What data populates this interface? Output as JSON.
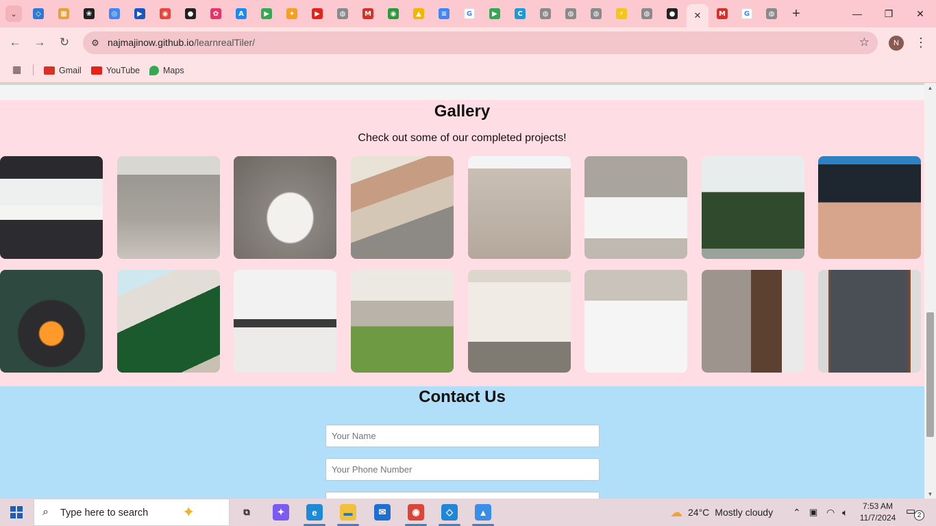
{
  "browser": {
    "tabs": [
      {
        "icon": "vscode-icon",
        "color": "#2c7ad6",
        "glyph": "◇"
      },
      {
        "icon": "analytics-icon",
        "color": "#e8a03a",
        "glyph": "▦"
      },
      {
        "icon": "chatgpt-icon",
        "color": "#222222",
        "glyph": "❀"
      },
      {
        "icon": "google-lens-icon",
        "color": "#4285f4",
        "glyph": "◎"
      },
      {
        "icon": "jira-icon",
        "color": "#1558c0",
        "glyph": "▶"
      },
      {
        "icon": "app-red-icon",
        "color": "#e8453c",
        "glyph": "◉"
      },
      {
        "icon": "github-icon",
        "color": "#222222",
        "glyph": "●"
      },
      {
        "icon": "butterfly-icon",
        "color": "#e8336b",
        "glyph": "✿"
      },
      {
        "icon": "app-store-icon",
        "color": "#1a8cf0",
        "glyph": "A"
      },
      {
        "icon": "google-play-icon",
        "color": "#34a853",
        "glyph": "▶"
      },
      {
        "icon": "pinwheel-icon",
        "color": "#f4a020",
        "glyph": "✦"
      },
      {
        "icon": "youtube-icon",
        "color": "#e62117",
        "glyph": "▶"
      },
      {
        "icon": "globe-icon",
        "color": "#8a8a8a",
        "glyph": "◍"
      },
      {
        "icon": "gmail-icon",
        "color": "#d93025",
        "glyph": "M"
      },
      {
        "icon": "circle-logo-icon",
        "color": "#2d9a3a",
        "glyph": "◉"
      },
      {
        "icon": "google-drive-icon",
        "color": "#f5b400",
        "glyph": "▲"
      },
      {
        "icon": "google-docs-icon",
        "color": "#4285f4",
        "glyph": "≡"
      },
      {
        "icon": "google-icon",
        "color": "#ffffff",
        "glyph": "G"
      },
      {
        "icon": "google-play-icon",
        "color": "#34a853",
        "glyph": "▶"
      },
      {
        "icon": "edge-c-icon",
        "color": "#1a9ad6",
        "glyph": "C"
      },
      {
        "icon": "globe-icon",
        "color": "#8a8a8a",
        "glyph": "◍"
      },
      {
        "icon": "globe-icon",
        "color": "#8a8a8a",
        "glyph": "◍"
      },
      {
        "icon": "globe-icon",
        "color": "#8a8a8a",
        "glyph": "◍"
      },
      {
        "icon": "bolt-icon",
        "color": "#f5c518",
        "glyph": "⚡"
      },
      {
        "icon": "globe-icon",
        "color": "#8a8a8a",
        "glyph": "◍"
      },
      {
        "icon": "github-icon",
        "color": "#222222",
        "glyph": "●"
      }
    ],
    "tabs_after_active": [
      {
        "icon": "gmail-icon",
        "color": "#d93025",
        "glyph": "M"
      },
      {
        "icon": "google-icon",
        "color": "#ffffff",
        "glyph": "G"
      },
      {
        "icon": "globe-icon",
        "color": "#8a8a8a",
        "glyph": "◍"
      }
    ],
    "active_tab_close": "✕",
    "url_host": "najmajinow.github.io",
    "url_path": "/learnrealTiler/",
    "profile_initial": "N",
    "bookmarks": [
      {
        "label": "Gmail",
        "icon": "gmail-icon",
        "color": "#d93025"
      },
      {
        "label": "YouTube",
        "icon": "youtube-icon",
        "color": "#e62117"
      },
      {
        "label": "Maps",
        "icon": "maps-icon",
        "color": "#34a853"
      }
    ]
  },
  "page": {
    "gallery": {
      "title": "Gallery",
      "subtitle": "Check out some of our completed projects!",
      "photos": [
        {
          "name": "kitchen-sink-photo",
          "bg": "linear-gradient(180deg,#2a2a2e 0 22%,#eef0f0 22% 48%,#f4f4f2 48% 62%,#2c2c30 62%)"
        },
        {
          "name": "grey-floor-tiles-photo",
          "bg": "linear-gradient(180deg,#d9d7d2 0 18%,#9b9792 18%,#a8a39d 60%,#c8c3bc 100%)"
        },
        {
          "name": "corner-bathtub-photo",
          "bg": "radial-gradient(ellipse at 55% 60%,#f3f1ee 0 28%,#8a8480 30%,#6e6863 100%)"
        },
        {
          "name": "outdoor-paving-photo",
          "bg": "linear-gradient(160deg,#e9e2d6 0 20%,#c69d82 20% 40%,#d5c7b6 40% 62%,#8d8984 62%)"
        },
        {
          "name": "patio-tiles-photo",
          "bg": "linear-gradient(180deg,#f2f4f5 0 12%,#c9bfb4 12%,#b4a89c 100%)"
        },
        {
          "name": "shower-tray-photo",
          "bg": "linear-gradient(180deg,#a9a49e 0 40%,#f4f4f4 40% 80%,#bfb9b2 80%)"
        },
        {
          "name": "green-shower-floor-photo",
          "bg": "linear-gradient(180deg,#e8ecec 0 35%,#2f4a2c 35% 90%,#9aa29c 90%)"
        },
        {
          "name": "blue-mosaic-floor-photo",
          "bg": "linear-gradient(180deg,#2c82c3 0 8%,#1e2630 8% 45%,#d7a58b 45%)"
        },
        {
          "name": "fireplace-photo",
          "bg": "radial-gradient(circle at 50% 62%,#ff9a2a 0 14%,#2c2b2d 16% 40%,#2e4a40 42%)"
        },
        {
          "name": "green-tiled-bath-photo",
          "bg": "linear-gradient(155deg,#cfe8ef 0 18%,#e2ddd6 18% 42%,#1b5a2d 42% 88%,#c9c0b4 88%)"
        },
        {
          "name": "tiled-kitchen-photo",
          "bg": "linear-gradient(180deg,#f2f2f2 0 48%,#3a3a3a 48% 56%,#ecebea 56%)"
        },
        {
          "name": "artificial-grass-patio-photo",
          "bg": "linear-gradient(180deg,#ece8e2 0 30%,#b9b3aa 30% 55%,#6e9a43 55%)"
        },
        {
          "name": "marble-shower-photo",
          "bg": "linear-gradient(180deg,#ddd6cd 0 12%,#f0ebe4 12% 70%,#7f7a72 70%)"
        },
        {
          "name": "marble-bath-tiles-photo",
          "bg": "linear-gradient(180deg,#c9c3bc 0 30%,#f5f5f5 30%)"
        },
        {
          "name": "tiler-selfie-photo",
          "bg": "linear-gradient(90deg,#9d958d 0 48%,#5d4130 48% 78%,#eaeaea 78%)"
        },
        {
          "name": "stone-feature-wall-photo",
          "bg": "linear-gradient(90deg,#d8d8d8 0 10%,#7e4c33 10% 12%,#4a4e55 12% 88%,#7e4c33 88% 90%,#dcdcdc 90%)"
        }
      ]
    },
    "contact": {
      "title": "Contact Us",
      "name_placeholder": "Your Name",
      "phone_placeholder": "Your Phone Number"
    }
  },
  "taskbar": {
    "search_placeholder": "Type here to search",
    "apps": [
      {
        "name": "task-view-icon",
        "color": "#e7d7dc",
        "glyph": "⧉",
        "fg": "#222"
      },
      {
        "name": "copilot-icon",
        "color": "#7a5cf0",
        "glyph": "✦",
        "fg": "#fff"
      },
      {
        "name": "edge-icon",
        "color": "#1c8ad6",
        "glyph": "e",
        "fg": "#fff"
      },
      {
        "name": "file-explorer-icon",
        "color": "#f2c13b",
        "glyph": "▬",
        "fg": "#1e78c8"
      },
      {
        "name": "mail-icon",
        "color": "#1f6fd0",
        "glyph": "✉",
        "fg": "#fff"
      },
      {
        "name": "chrome-icon",
        "color": "#db4437",
        "glyph": "◉",
        "fg": "#fff"
      },
      {
        "name": "vscode-icon",
        "color": "#1f86d8",
        "glyph": "◇",
        "fg": "#fff"
      },
      {
        "name": "photos-icon",
        "color": "#3a8ee6",
        "glyph": "▲",
        "fg": "#fff"
      }
    ],
    "weather_temp": "24°C",
    "weather_desc": "Mostly cloudy",
    "time": "7:53 AM",
    "date": "11/7/2024",
    "notification_count": "2"
  }
}
